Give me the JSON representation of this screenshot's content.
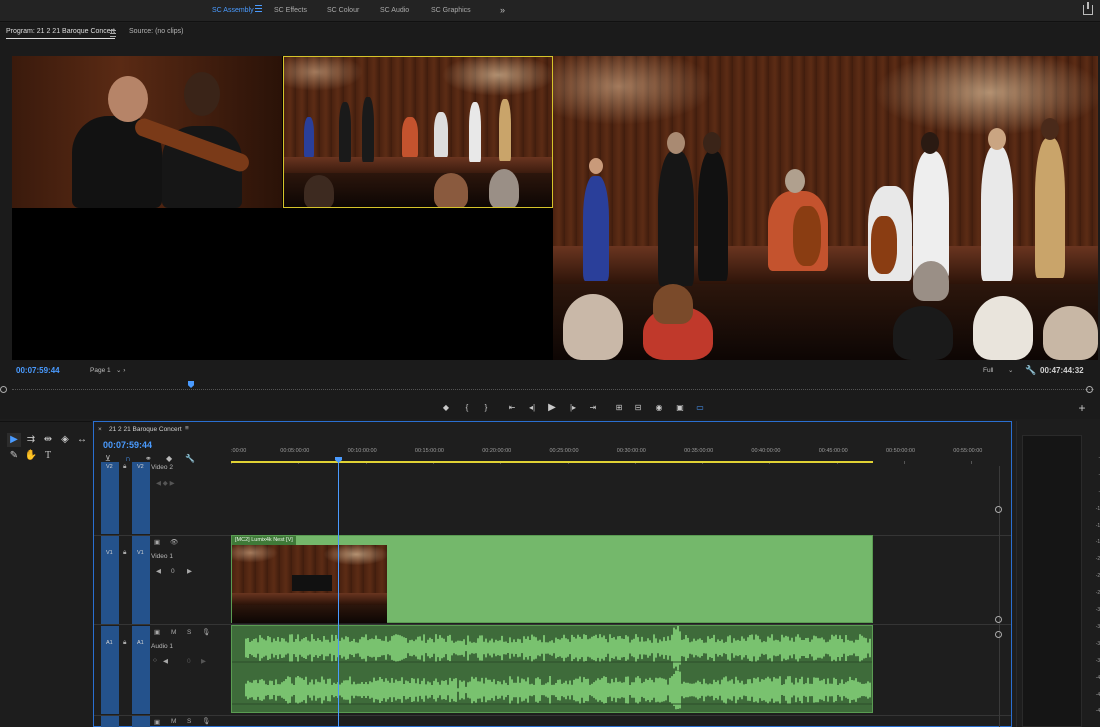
{
  "workspaces": {
    "tabs": [
      "SC Assembly",
      "SC Effects",
      "SC Colour",
      "SC Audio",
      "SC Graphics"
    ],
    "active": "SC Assembly",
    "more": "»"
  },
  "monitor": {
    "program_tab": "Program: 21 2 21 Baroque Concert",
    "source_tab": "Source: (no clips)",
    "current_tc": "00:07:59:44",
    "page": "Page 1",
    "quality": "Full",
    "duration_tc": "00:47:44:32",
    "playhead_fraction": 0.167
  },
  "timeline": {
    "sequence_name": "21 2 21 Baroque Concert",
    "current_tc": "00:07:59:44",
    "ruler": [
      ":00:00",
      "00:05:00:00",
      "00:10:00:00",
      "00:15:00:00",
      "00:20:00:00",
      "00:25:00:00",
      "00:30:00:00",
      "00:35:00:00",
      "00:40:00:00",
      "00:45:00:00",
      "00:50:00:00",
      "00:55:00:00"
    ],
    "tracks": {
      "v2": {
        "src": "V2",
        "tgt": "V2",
        "name": "Video 2"
      },
      "v1": {
        "src": "V1",
        "tgt": "V1",
        "name": "Video 1"
      },
      "a1": {
        "src": "A1",
        "tgt": "A1",
        "name": "Audio 1"
      }
    },
    "clip_video_label": "[MC2] Lumix4k Nest [V]",
    "zero": "0",
    "mute": "M",
    "solo": "S"
  },
  "meters": {
    "scale": [
      "0",
      "-3",
      "-6",
      "-9",
      "-12",
      "-15",
      "-18",
      "-21",
      "-24",
      "-27",
      "-30",
      "-33",
      "-36",
      "-39",
      "-42",
      "-45",
      "-48"
    ]
  },
  "colors": {
    "accent_blue": "#4a9bff",
    "track_blue": "#24528c",
    "clip_green": "#74b86b",
    "work_area_yellow": "#e0d234"
  }
}
